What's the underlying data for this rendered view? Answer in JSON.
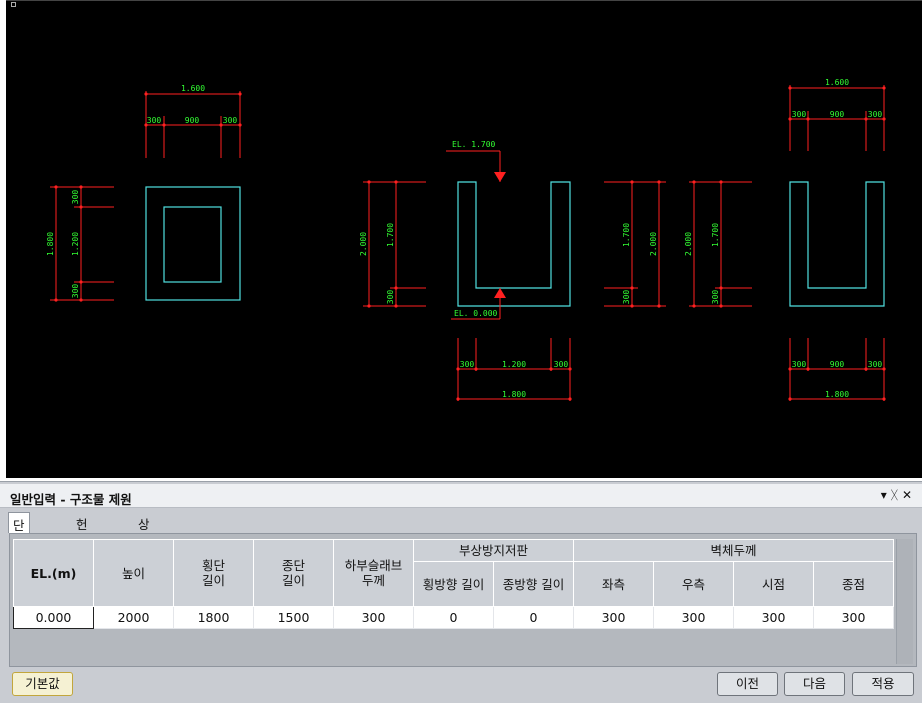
{
  "panel": {
    "title": "일반입력 - 구조물 제원",
    "controls": "▾ ⊣ ✕"
  },
  "tabs": [
    {
      "label": "단면제원",
      "active": true
    },
    {
      "label": "헌치제원",
      "active": false
    },
    {
      "label": "상부슬래브",
      "active": false
    }
  ],
  "grid": {
    "headers": {
      "el": "EL.(m)",
      "height": "높이",
      "transverse_length": "횡단\n길이",
      "longitudinal_length": "종단\n길이",
      "bottom_slab": "하부슬래브\n두께",
      "uplift_group": "부상방지저판",
      "uplift_transverse": "횡방향 길이",
      "uplift_longitudinal": "종방향 길이",
      "wall_group": "벽체두께",
      "wall_left": "좌측",
      "wall_right": "우측",
      "wall_start": "시점",
      "wall_end": "종점"
    },
    "row": {
      "el": "0.000",
      "height": "2000",
      "transverse_length": "1800",
      "longitudinal_length": "1500",
      "bottom_slab": "300",
      "uplift_transverse": "0",
      "uplift_longitudinal": "0",
      "wall_left": "300",
      "wall_right": "300",
      "wall_start": "300",
      "wall_end": "300"
    }
  },
  "buttons": {
    "default": "기본값",
    "prev": "이전",
    "next": "다음",
    "apply": "적용"
  },
  "drawing": {
    "colors": {
      "dimension": "#ff2020",
      "dim_text": "#33ff33",
      "structure": "#4fe0e0",
      "background": "#000000"
    },
    "labels": {
      "d1600": "1.600",
      "d1800": "1.800",
      "d2000": "2.000",
      "d1700": "1.700",
      "d1200": "1.200",
      "d900": "900",
      "d300": "300",
      "el_top": "EL. 1.700",
      "el_bottom": "EL. 0.000"
    }
  }
}
